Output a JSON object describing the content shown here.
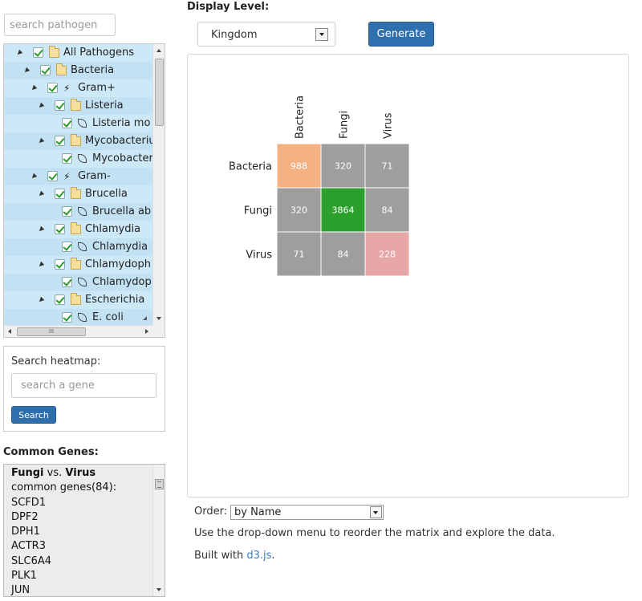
{
  "pathogen_search": {
    "placeholder": "search pathogen"
  },
  "tree": {
    "items": [
      {
        "label": "All Pathogens",
        "icon": "folder",
        "depth": 0,
        "expanded": true
      },
      {
        "label": "Bacteria",
        "icon": "folder",
        "depth": 1,
        "expanded": true
      },
      {
        "label": "Gram+",
        "icon": "bolt",
        "depth": 2,
        "expanded": true
      },
      {
        "label": "Listeria",
        "icon": "folder",
        "depth": 3,
        "expanded": true
      },
      {
        "label": "Listeria mo",
        "icon": "leaf",
        "depth": 4
      },
      {
        "label": "Mycobacteriu",
        "icon": "folder",
        "depth": 3,
        "expanded": true
      },
      {
        "label": "Mycobacter",
        "icon": "leaf",
        "depth": 4
      },
      {
        "label": "Gram-",
        "icon": "bolt",
        "depth": 2,
        "expanded": true
      },
      {
        "label": "Brucella",
        "icon": "folder",
        "depth": 3,
        "expanded": true
      },
      {
        "label": "Brucella ab",
        "icon": "leaf",
        "depth": 4
      },
      {
        "label": "Chlamydia",
        "icon": "folder",
        "depth": 3,
        "expanded": true
      },
      {
        "label": "Chlamydia",
        "icon": "leaf",
        "depth": 4
      },
      {
        "label": "Chlamydoph",
        "icon": "folder",
        "depth": 3,
        "expanded": true
      },
      {
        "label": "Chlamydop",
        "icon": "leaf",
        "depth": 4
      },
      {
        "label": "Escherichia",
        "icon": "folder",
        "depth": 3,
        "expanded": true
      },
      {
        "label": "E. coli",
        "icon": "leaf",
        "depth": 4
      }
    ],
    "hscroll_grip": "III"
  },
  "heatmap_search": {
    "label": "Search heatmap:",
    "placeholder": "search a gene",
    "button": "Search"
  },
  "common_genes": {
    "title": "Common Genes:",
    "group_a": "Fungi",
    "vs": "vs.",
    "group_b": "Virus",
    "count_text": "common genes(84):",
    "genes": [
      "SCFD1",
      "DPF2",
      "DPH1",
      "ACTR3",
      "SLC6A4",
      "PLK1",
      "JUN"
    ]
  },
  "display_level": {
    "label": "Display Level:",
    "selected": "Kingdom",
    "generate": "Generate"
  },
  "order": {
    "label": "Order:",
    "selected": "by Name"
  },
  "help_text": "Use the drop-down menu to reorder the matrix and explore the data.",
  "built_with": {
    "prefix": "Built with ",
    "link": "d3.js",
    "suffix": "."
  },
  "chart_data": {
    "type": "heatmap",
    "rows": [
      "Bacteria",
      "Fungi",
      "Virus"
    ],
    "columns": [
      "Bacteria",
      "Fungi",
      "Virus"
    ],
    "values": [
      [
        988,
        320,
        71
      ],
      [
        320,
        3864,
        84
      ],
      [
        71,
        84,
        228
      ]
    ],
    "diagonal_colors": [
      "#f4b183",
      "#2ca02c",
      "#e8a7a7"
    ],
    "offdiagonal_color": "#9e9e9e"
  }
}
